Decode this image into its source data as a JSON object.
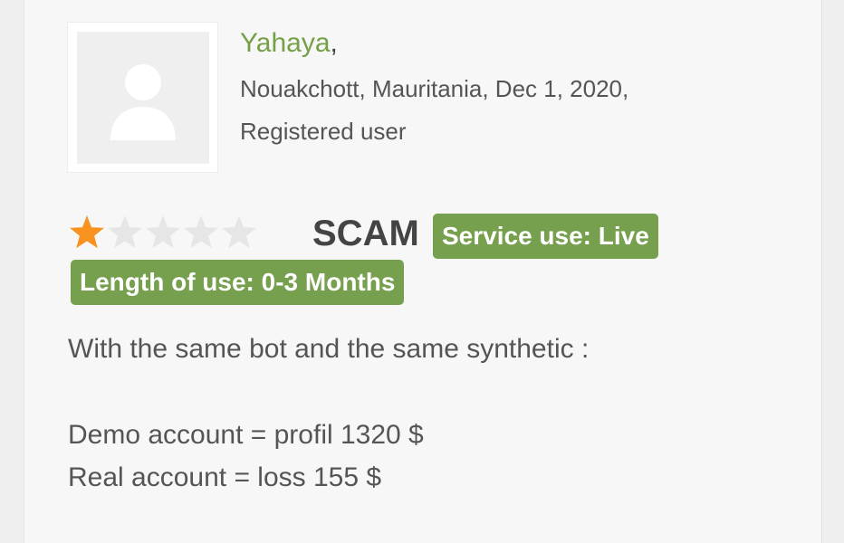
{
  "review": {
    "author_name": "Yahaya",
    "author_suffix": ",",
    "location_date": "Nouakchott, Mauritania, Dec 1, 2020,",
    "user_type": "Registered user",
    "rating": 1,
    "rating_max": 5,
    "verdict": "SCAM",
    "badges": {
      "service_use": "Service use: Live",
      "length_of_use": "Length of use: 0-3 Months"
    },
    "body_lines": [
      "With the same bot and the same synthetic :",
      "Demo account = profil 1320 $",
      "Real account = loss 155 $"
    ]
  },
  "colors": {
    "accent_green": "#76a04d",
    "star_filled": "#f7931e",
    "star_empty": "#e6e6e6",
    "name_green": "#75a047"
  },
  "icons": {
    "avatar": "user-silhouette-icon",
    "star": "star-icon"
  }
}
